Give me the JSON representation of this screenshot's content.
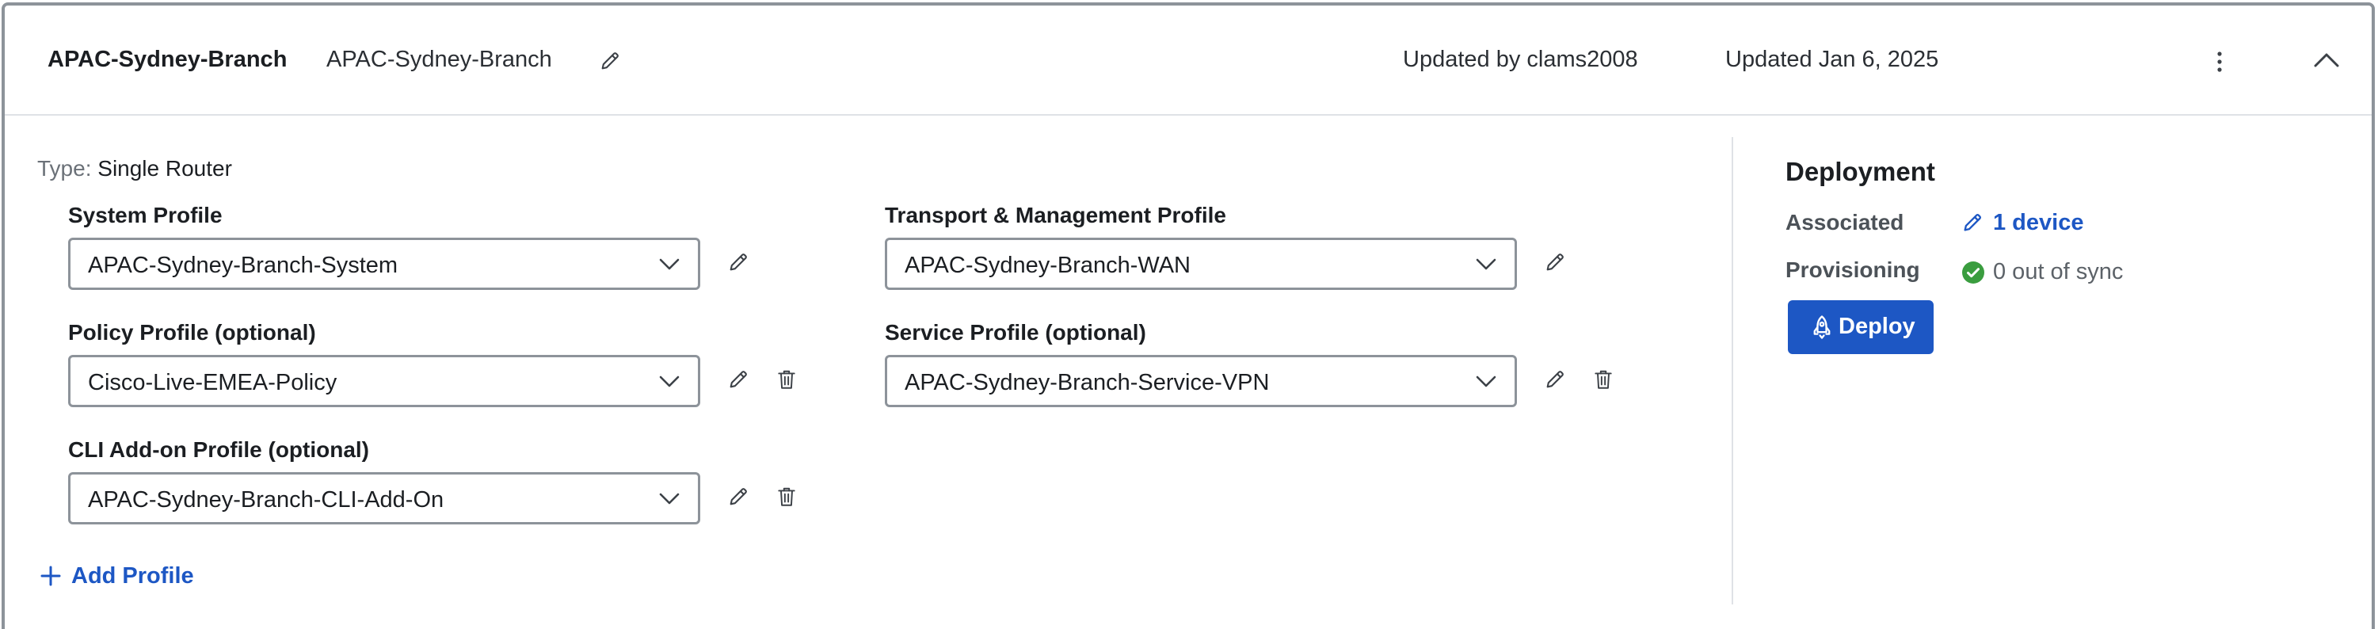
{
  "header": {
    "config_name": "APAC-Sydney-Branch",
    "config_name_editable": "APAC-Sydney-Branch",
    "updated_by": "Updated by clams2008",
    "updated_date": "Updated Jan 6, 2025",
    "icons": [
      "pencil-icon",
      "more-vertical-icon",
      "chevron-up-icon"
    ]
  },
  "main": {
    "type_label": "Type:",
    "type_value": "Single Router",
    "profiles": {
      "system": {
        "label": "System Profile",
        "value": "APAC-Sydney-Branch-System"
      },
      "transport": {
        "label": "Transport & Management Profile",
        "value": "APAC-Sydney-Branch-WAN"
      },
      "policy": {
        "label": "Policy Profile (optional)",
        "value": "Cisco-Live-EMEA-Policy"
      },
      "service": {
        "label": "Service Profile (optional)",
        "value": "APAC-Sydney-Branch-Service-VPN"
      },
      "cli": {
        "label": "CLI Add-on Profile (optional)",
        "value": "APAC-Sydney-Branch-CLI-Add-On"
      }
    },
    "add_profile_label": "Add Profile"
  },
  "deployment": {
    "title": "Deployment",
    "associated_label": "Associated",
    "associated_value": "1 device",
    "provisioning_label": "Provisioning",
    "provisioning_value": "0 out of sync",
    "deploy_label": "Deploy"
  },
  "colors": {
    "accent": "#1d57c4",
    "success": "#3a9d3f",
    "border": "#8d939a"
  }
}
